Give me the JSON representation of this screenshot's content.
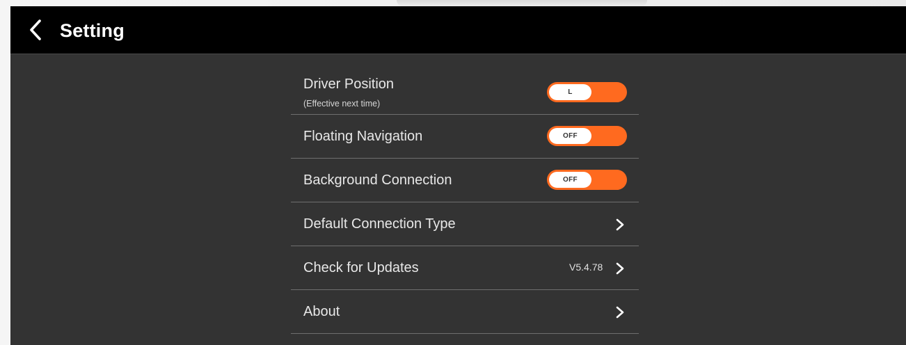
{
  "header": {
    "title": "Setting",
    "back_icon": "chevron-left-icon"
  },
  "colors": {
    "accent": "#ff6a1f",
    "header_bg": "#000000",
    "body_bg": "#333333",
    "divider": "#6f6f6f"
  },
  "settings": {
    "driver_position": {
      "label": "Driver Position",
      "sublabel": "(Effective next time)",
      "value": "L"
    },
    "floating_navigation": {
      "label": "Floating Navigation",
      "value": "OFF"
    },
    "background_connection": {
      "label": "Background Connection",
      "value": "OFF"
    },
    "default_connection_type": {
      "label": "Default Connection Type",
      "icon": "chevron-right-icon"
    },
    "check_for_updates": {
      "label": "Check for Updates",
      "version": "V5.4.78",
      "icon": "chevron-right-icon"
    },
    "about": {
      "label": "About",
      "icon": "chevron-right-icon"
    }
  }
}
